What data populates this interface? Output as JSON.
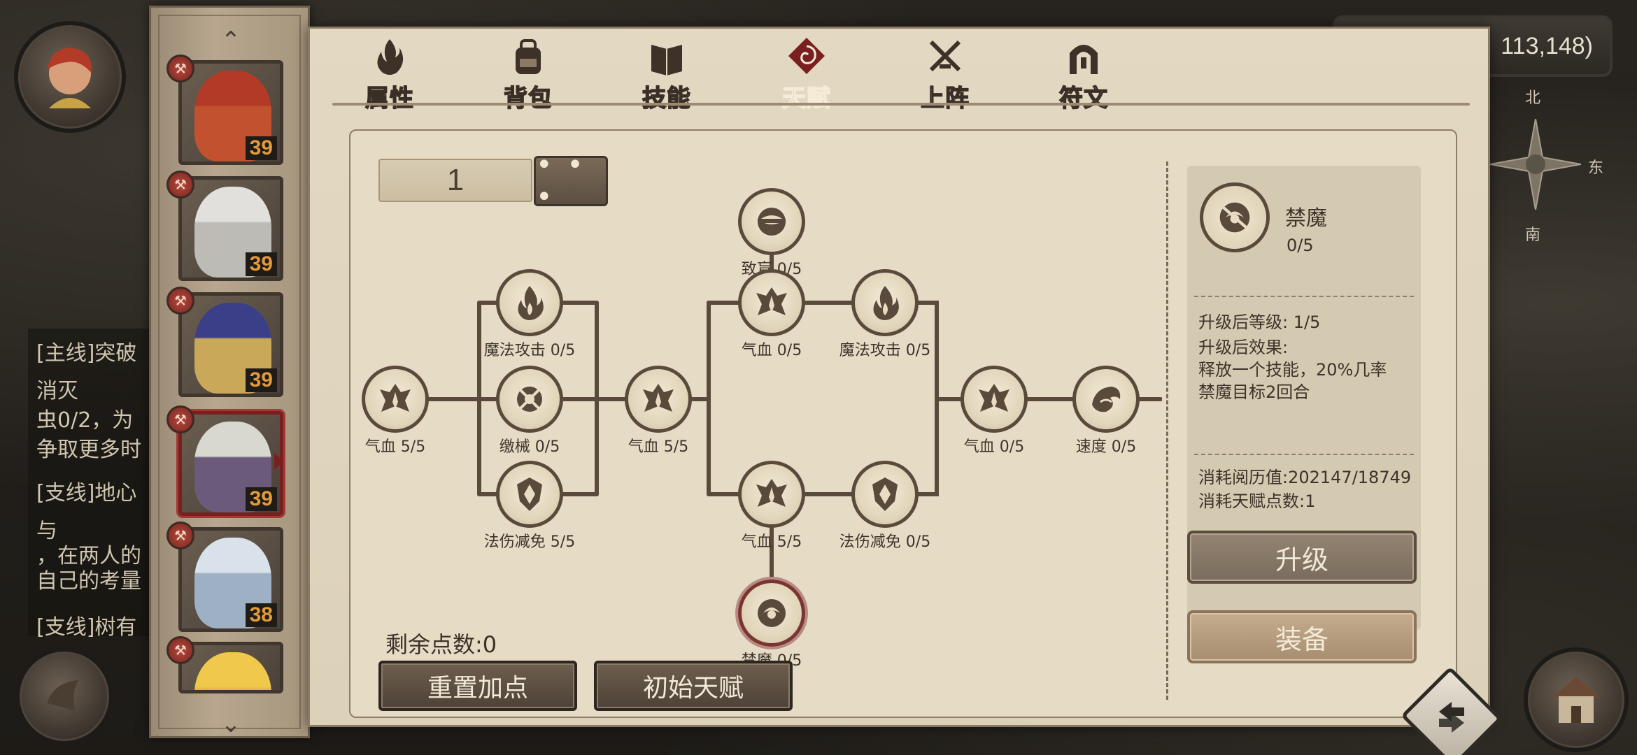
{
  "world": {
    "coordinates": "113,148)",
    "compass": {
      "north": "北",
      "east": "东",
      "south": "南"
    },
    "quests": [
      {
        "text": "[主线]突破"
      },
      {
        "text": "消灭"
      },
      {
        "text": "虫0/2，为"
      },
      {
        "text": "争取更多时"
      },
      {
        "text": "[支线]地心"
      },
      {
        "text": "与"
      },
      {
        "text": "，在两人的"
      },
      {
        "text": "自己的考量"
      },
      {
        "text": "[支线]树有"
      }
    ]
  },
  "heroes": [
    {
      "level": "39",
      "color": "#c2512f",
      "hair": "#b33a26"
    },
    {
      "level": "39",
      "color": "#bdbbb6",
      "hair": "#e2e0dc"
    },
    {
      "level": "39",
      "color": "#caa85a",
      "hair": "#3a3f87"
    },
    {
      "level": "39",
      "color": "#6b5a7a",
      "hair": "#d8d8d0"
    },
    {
      "level": "38",
      "color": "#9eb1c4",
      "hair": "#d9e2ea"
    },
    {
      "level": "",
      "color": "#e3b94a",
      "hair": "#f0c84b"
    }
  ],
  "tabs": [
    {
      "label": "属性",
      "icon": "flame-icon"
    },
    {
      "label": "背包",
      "icon": "backpack-icon"
    },
    {
      "label": "技能",
      "icon": "book-icon"
    },
    {
      "label": "天赋",
      "icon": "talent-swirl-icon",
      "active": true
    },
    {
      "label": "上阵",
      "icon": "crossed-swords-icon"
    },
    {
      "label": "符文",
      "icon": "rune-gate-icon"
    }
  ],
  "talent": {
    "page_value": "1",
    "more_label": "• • •",
    "remaining_points": "剩余点数:0",
    "reset_label": "重置加点",
    "initial_label": "初始天赋",
    "nodes": [
      {
        "label": "气血 5/5",
        "icon": "vitality-icon"
      },
      {
        "label": "魔法攻击 0/5",
        "icon": "magic-flame-icon"
      },
      {
        "label": "缴械 0/5",
        "icon": "disarm-icon"
      },
      {
        "label": "法伤减免 5/5",
        "icon": "magic-shield-icon"
      },
      {
        "label": "气血 5/5",
        "icon": "vitality-icon"
      },
      {
        "label": "致盲 0/5",
        "icon": "blind-icon"
      },
      {
        "label": "气血 0/5",
        "icon": "vitality-icon"
      },
      {
        "label": "气血 5/5",
        "icon": "vitality-icon"
      },
      {
        "label": "禁魔 0/5",
        "icon": "silence-icon"
      },
      {
        "label": "魔法攻击 0/5",
        "icon": "magic-flame-icon"
      },
      {
        "label": "法伤减免 0/5",
        "icon": "magic-shield-icon"
      },
      {
        "label": "气血 0/5",
        "icon": "vitality-icon"
      },
      {
        "label": "速度 0/5",
        "icon": "speed-icon"
      }
    ]
  },
  "detail": {
    "name": "禁魔",
    "count": "0/5",
    "next_level": "升级后等级: 1/5",
    "effect_title": "升级后效果:",
    "effect_line1": "释放一个技能，20%几率",
    "effect_line2": "禁魔目标2回合",
    "cost_exp": "消耗阅历值:202147/18749",
    "cost_points": "消耗天赋点数:1",
    "upgrade_label": "升级",
    "equip_label": "装备"
  }
}
